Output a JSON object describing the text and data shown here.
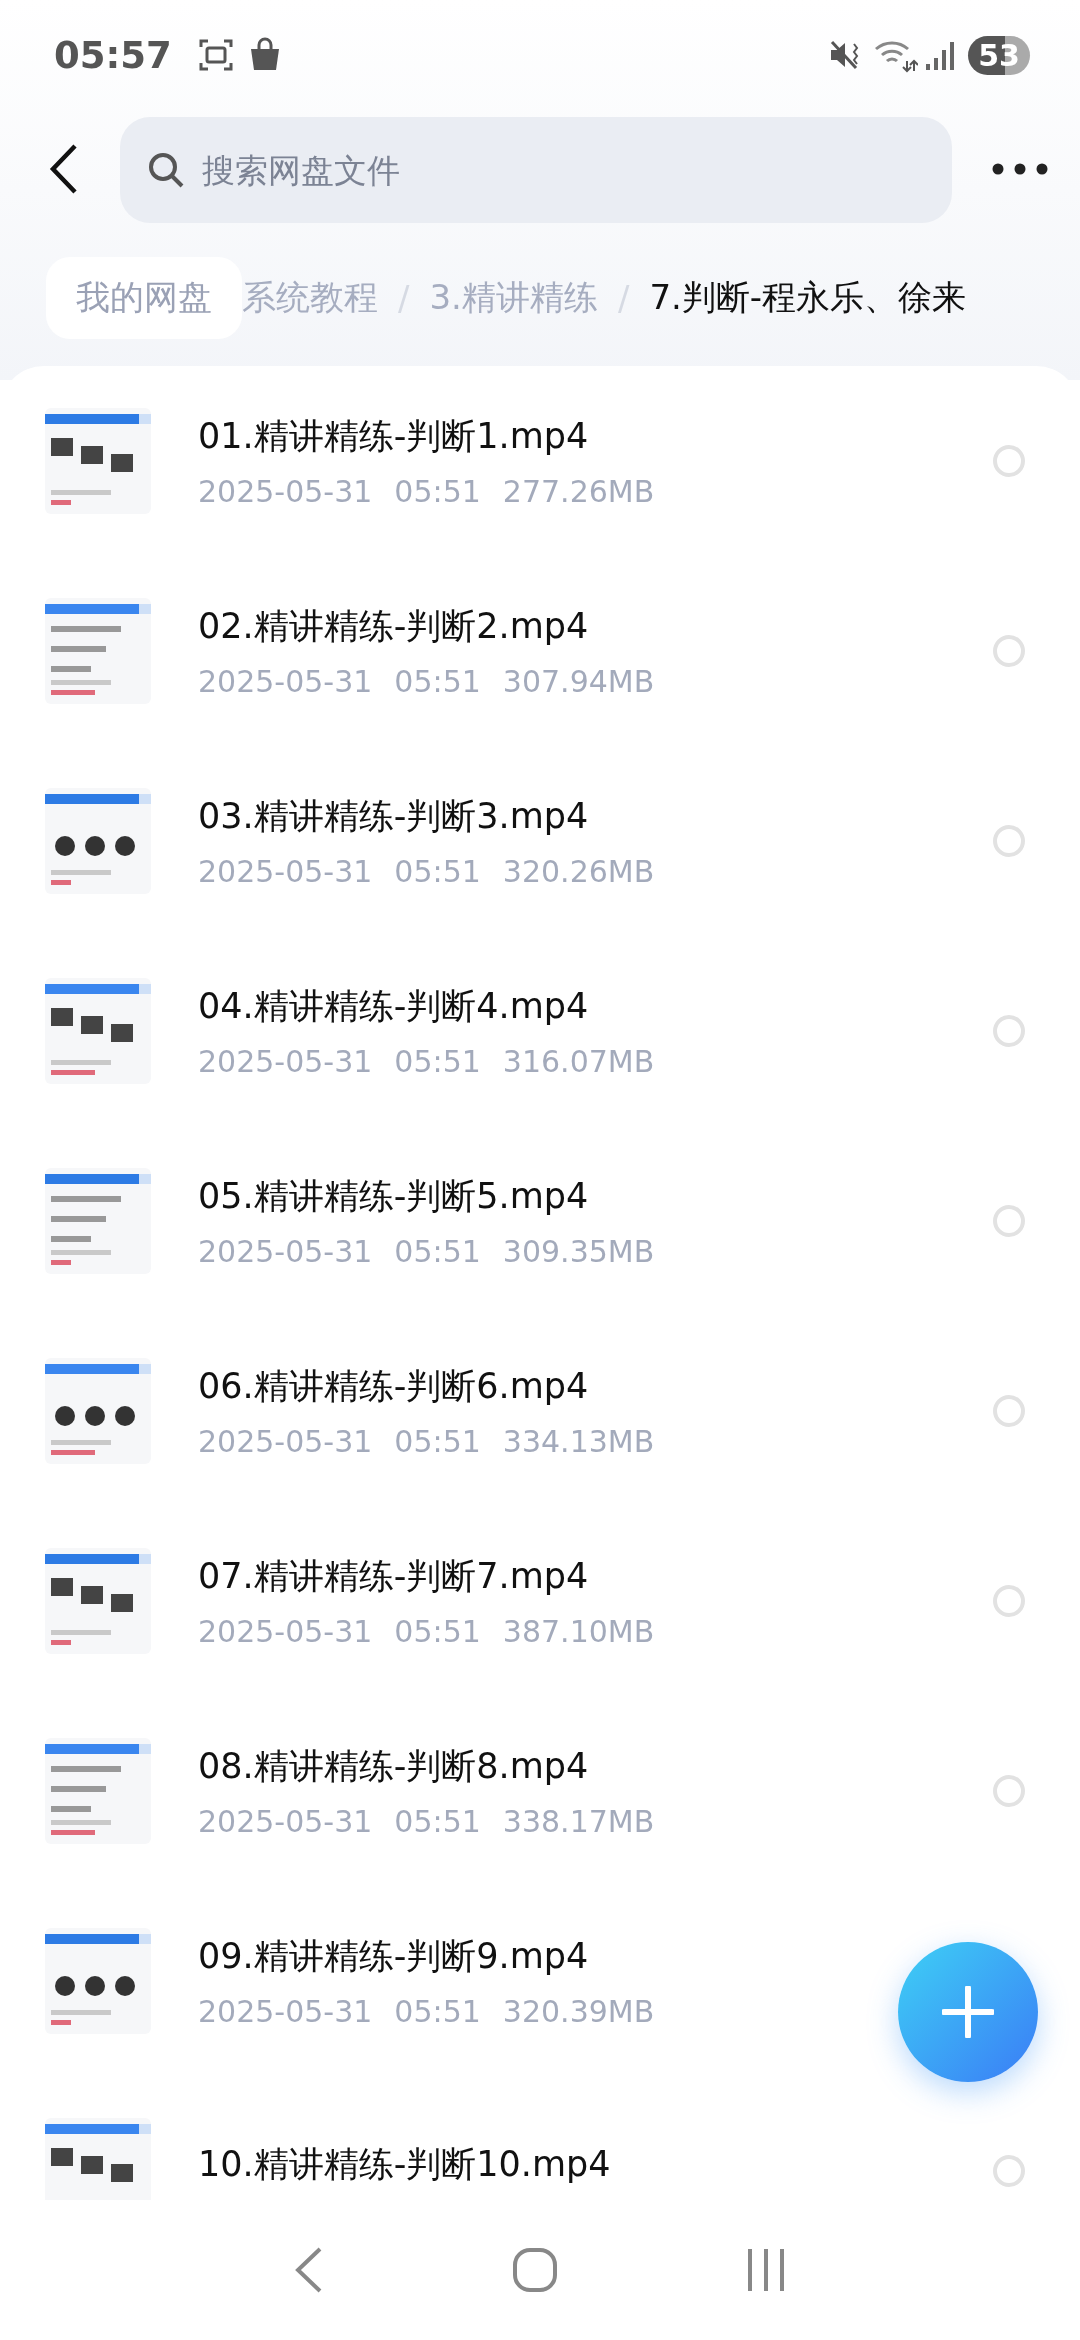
{
  "status_bar": {
    "time": "05:57",
    "battery": "53"
  },
  "search": {
    "placeholder": "搜索网盘文件"
  },
  "breadcrumb": [
    {
      "label": "我的网盘",
      "kind": "root"
    },
    {
      "label": "系统教程",
      "kind": "crumb"
    },
    {
      "separator": "/",
      "label": "3.精讲精练",
      "kind": "crumb"
    },
    {
      "separator": "/",
      "label": "7.判断-程永乐、徐来",
      "kind": "current"
    }
  ],
  "files": [
    {
      "name": "01.精讲精练-判断1.mp4",
      "date": "2025-05-31",
      "time": "05:51",
      "size": "277.26MB",
      "selected": false
    },
    {
      "name": "02.精讲精练-判断2.mp4",
      "date": "2025-05-31",
      "time": "05:51",
      "size": "307.94MB",
      "selected": false
    },
    {
      "name": "03.精讲精练-判断3.mp4",
      "date": "2025-05-31",
      "time": "05:51",
      "size": "320.26MB",
      "selected": false
    },
    {
      "name": "04.精讲精练-判断4.mp4",
      "date": "2025-05-31",
      "time": "05:51",
      "size": "316.07MB",
      "selected": false
    },
    {
      "name": "05.精讲精练-判断5.mp4",
      "date": "2025-05-31",
      "time": "05:51",
      "size": "309.35MB",
      "selected": false
    },
    {
      "name": "06.精讲精练-判断6.mp4",
      "date": "2025-05-31",
      "time": "05:51",
      "size": "334.13MB",
      "selected": false
    },
    {
      "name": "07.精讲精练-判断7.mp4",
      "date": "2025-05-31",
      "time": "05:51",
      "size": "387.10MB",
      "selected": false
    },
    {
      "name": "08.精讲精练-判断8.mp4",
      "date": "2025-05-31",
      "time": "05:51",
      "size": "338.17MB",
      "selected": false
    },
    {
      "name": "09.精讲精练-判断9.mp4",
      "date": "2025-05-31",
      "time": "05:51",
      "size": "320.39MB"
    },
    {
      "name": "10.精讲精练-判断10.mp4",
      "selected": false
    }
  ]
}
